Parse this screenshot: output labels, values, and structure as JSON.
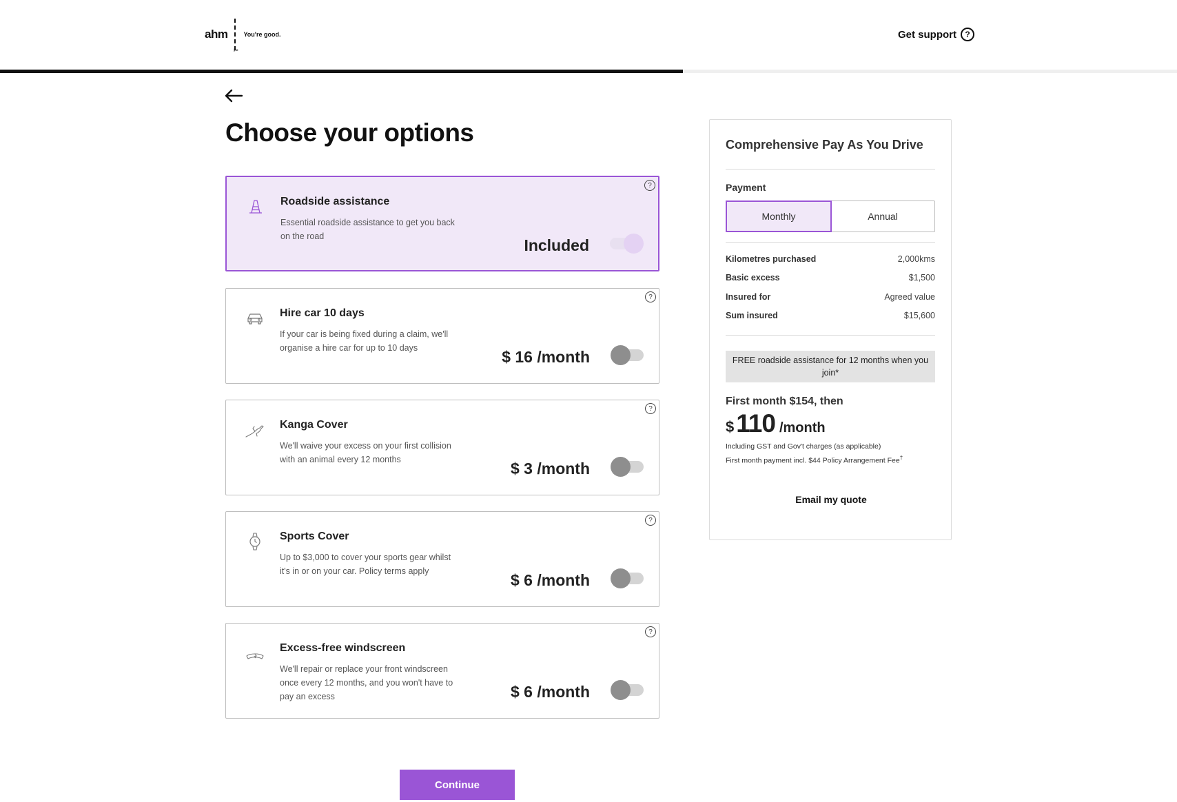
{
  "header": {
    "logo_word": "ahm",
    "logo_tagline": "You're good.",
    "support_label": "Get support",
    "support_icon": "?"
  },
  "progress": {
    "fraction": 0.58
  },
  "page": {
    "title": "Choose your options"
  },
  "options": [
    {
      "title": "Roadside assistance",
      "desc": "Essential roadside assistance to get you back on the road",
      "price": "Included",
      "icon": "traffic-cone-icon",
      "selected": true
    },
    {
      "title": "Hire car 10 days",
      "desc": "If your car is being fixed during a claim, we'll organise a hire car for up to 10 days",
      "price": "$ 16 /month",
      "icon": "car-icon",
      "selected": false
    },
    {
      "title": "Kanga Cover",
      "desc": "We'll waive your excess on your first collision with an animal every 12 months",
      "price": "$ 3 /month",
      "icon": "kangaroo-icon",
      "selected": false
    },
    {
      "title": "Sports Cover",
      "desc": "Up to $3,000 to cover your sports gear whilst it's in or on your car. Policy terms apply",
      "price": "$ 6 /month",
      "icon": "watch-icon",
      "selected": false
    },
    {
      "title": "Excess-free windscreen",
      "desc": "We'll repair or replace your front windscreen once every 12 months, and you won't have to pay an excess",
      "price": "$ 6 /month",
      "icon": "windscreen-icon",
      "selected": false
    }
  ],
  "continue_label": "Continue",
  "summary": {
    "title": "Comprehensive Pay As You Drive",
    "payment_label": "Payment",
    "monthly_label": "Monthly",
    "annual_label": "Annual",
    "details": [
      {
        "key": "Kilometres purchased",
        "value": "2,000kms"
      },
      {
        "key": "Basic excess",
        "value": "$1,500"
      },
      {
        "key": "Insured for",
        "value": "Agreed value"
      },
      {
        "key": "Sum insured",
        "value": "$15,600"
      }
    ],
    "promo": "FREE roadside assistance for 12 months when you join*",
    "first_month": "First month $154, then",
    "price_currency": "$",
    "price_amount": "110",
    "price_period": "/month",
    "fine_1": "Including GST and Gov't charges (as applicable)",
    "fine_2": "First month payment incl. $44 Policy Arrangement Fee",
    "fine_2_mark": "†",
    "email_label": "Email my quote"
  },
  "colors": {
    "accent": "#9a55d6",
    "selected_bg": "#f1e8f8"
  }
}
